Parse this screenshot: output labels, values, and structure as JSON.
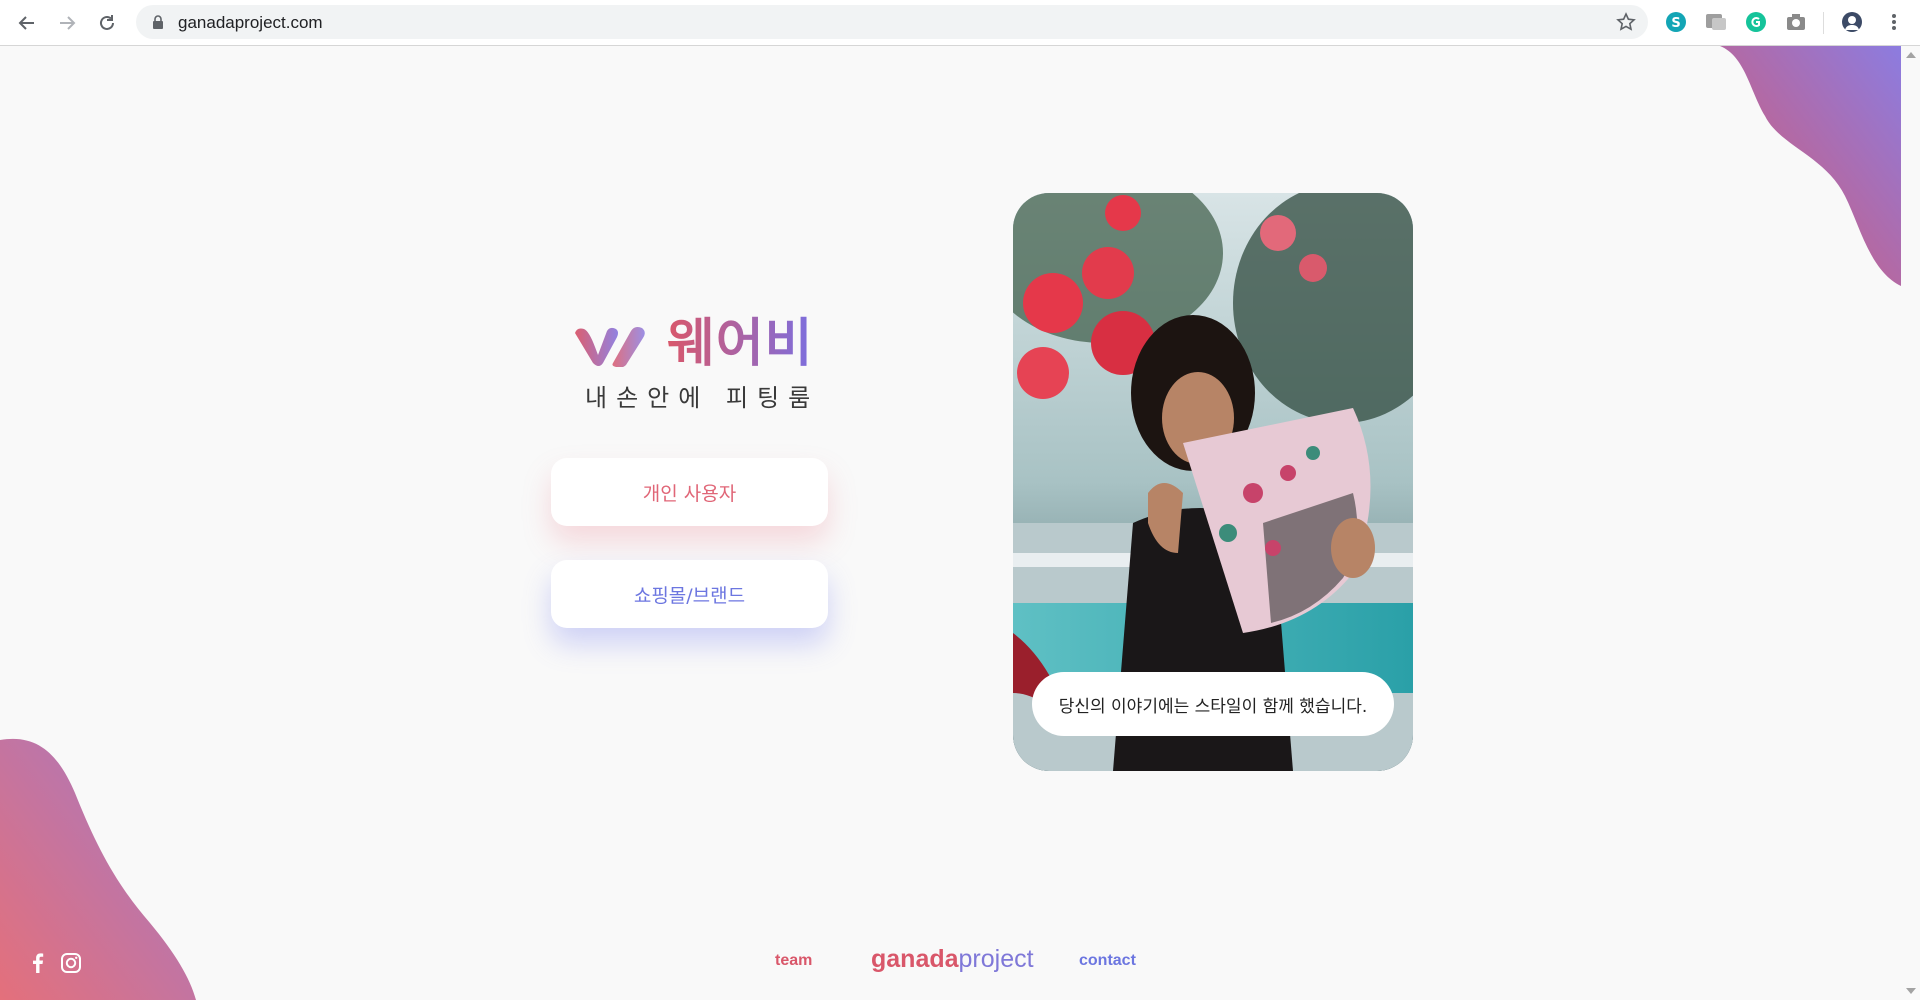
{
  "browser": {
    "url": "ganadaproject.com",
    "nav_icons": [
      "back-arrow-icon",
      "forward-arrow-icon",
      "reload-icon"
    ],
    "extensions": [
      "skype-icon",
      "translate-icon",
      "grammarly-icon",
      "camera-icon",
      "profile-avatar-icon"
    ]
  },
  "brand": {
    "name": "웨어비",
    "tagline": "내손안에 피팅룸",
    "colors": {
      "pink": "#d9576a",
      "purple": "#7b6fe0"
    }
  },
  "choices": {
    "personal_label": "개인 사용자",
    "brand_label": "쇼핑몰/브랜드"
  },
  "hero": {
    "caption": "당신의 이야기에는 스타일이 함께 했습니다."
  },
  "footer": {
    "team_label": "team",
    "logo_part1": "ganada",
    "logo_part2": "project",
    "contact_label": "contact",
    "social_icons": [
      "facebook-icon",
      "instagram-icon"
    ]
  }
}
